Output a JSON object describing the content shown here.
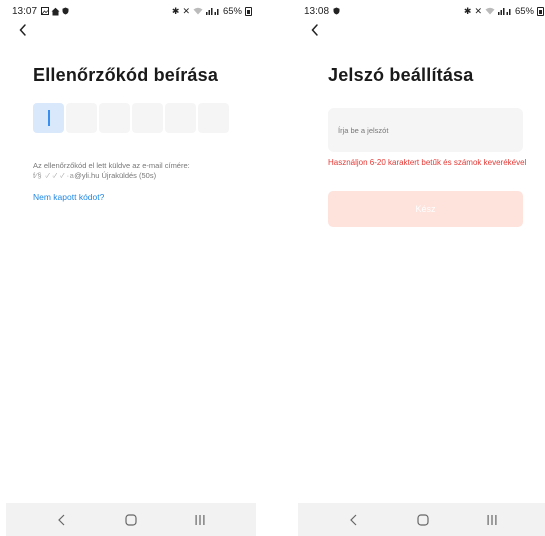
{
  "left_screen": {
    "status": {
      "time": "13:07",
      "battery": "65%"
    },
    "title": "Ellenőrzőkód beírása",
    "code_length": 6,
    "info_line1": "Az ellenőrzőkód el lett küldve az e-mail címére:",
    "masked_email": "f⁄§ ·⁄ ·⁄ ·⁄ ·a",
    "email_suffix": "@yli.hu",
    "resend_label": "Újraküldés (50s)",
    "no_code_link": "Nem kapott kódot?"
  },
  "right_screen": {
    "status": {
      "time": "13:08",
      "battery": "65%"
    },
    "title": "Jelszó beállítása",
    "password_placeholder": "Írja be a jelszót",
    "error_text": "Használjon 6-20 karaktert betűk és számok keverékével",
    "done_label": "Kész"
  },
  "icons": {
    "back": "chevron-left-icon",
    "nav_back": "nav-back-icon",
    "nav_home": "nav-home-icon",
    "nav_recents": "nav-recents-icon"
  },
  "colors": {
    "accent_link": "#1e88e5",
    "error": "#e53935",
    "done_disabled_bg": "#fde3dc",
    "active_box": "#d9e8fb"
  }
}
